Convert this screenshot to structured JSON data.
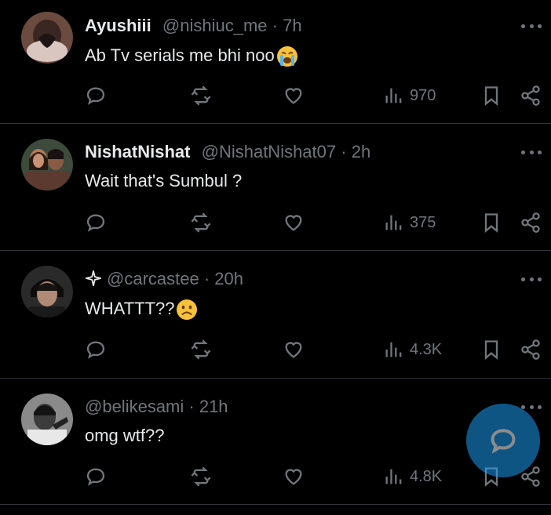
{
  "tweets": [
    {
      "name": "Ayushiii",
      "handle": "@nishiuc_me",
      "sep": " · ",
      "time": "7h",
      "text": "Ab Tv serials me bhi noo",
      "emoji": "loudly-crying-face",
      "views": "970"
    },
    {
      "name": "NishatNishat",
      "handle": "@NishatNishat07",
      "sep": " · ",
      "time": "2h",
      "text": "Wait that's Sumbul  ?",
      "emoji": "",
      "views": "375"
    },
    {
      "name": "",
      "handle": "@carcastee",
      "sep": " · ",
      "time": "20h",
      "text": "WHATTT??",
      "emoji": "frowning-face",
      "views": "4.3K"
    },
    {
      "name": "",
      "handle": "@belikesami",
      "sep": " · ",
      "time": "21h",
      "text": "omg wtf??",
      "emoji": "",
      "views": "4.8K"
    }
  ],
  "icons": {
    "reply": "reply-icon",
    "retweet": "retweet-icon",
    "like": "like-icon",
    "views": "views-icon",
    "bookmark": "bookmark-icon",
    "share": "share-icon",
    "more": "more-icon",
    "compose": "compose-reply-icon",
    "verified_sparkle": "sparkle-icon"
  },
  "colors": {
    "background": "#000000",
    "text": "#e7e9ea",
    "muted": "#71767b",
    "divider": "#2f3336",
    "accent": "#1d9bf0"
  }
}
